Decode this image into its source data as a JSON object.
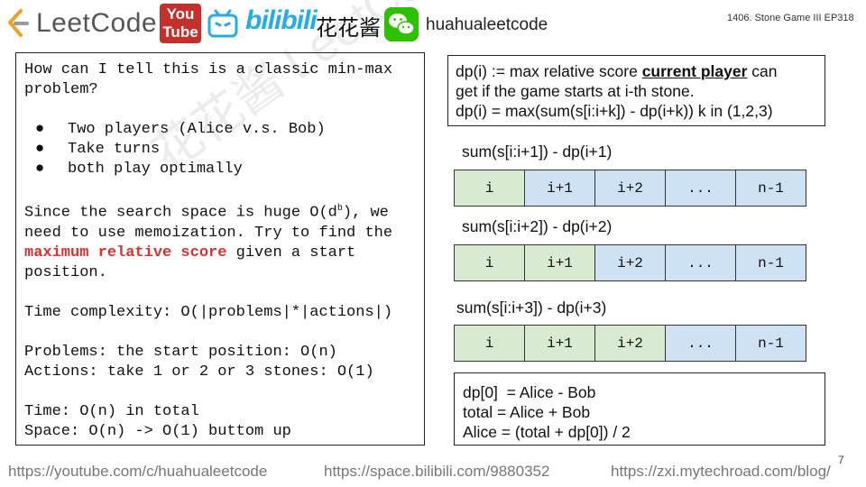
{
  "header": {
    "brand": "LeetCode",
    "youtube_top": "You",
    "youtube_bottom": "Tube",
    "bilibili": "bilibili",
    "chinese_name": "花花酱",
    "handle": "huahualeetcode",
    "slide_id": "1406. Stone Game III EP318"
  },
  "left": {
    "question": "How can I tell this is a classic min-max problem?",
    "bullets": [
      "Two players (Alice v.s. Bob)",
      "Take turns",
      "both play optimally"
    ],
    "memo_pre": "Since the search space is huge O(d",
    "memo_sup": "b",
    "memo_post": "), we need to use memoization. Try to find the",
    "memo_red": "maximum relative score",
    "memo_end": "given a start position.",
    "time_complexity": "Time complexity: O(|problems|*|actions|)",
    "problems": "Problems: the start position: O(n)",
    "actions": "Actions: take 1 or 2 or 3 stones: O(1)",
    "time": "Time: O(n) in total",
    "space": "Space: O(n) -> O(1) buttom up"
  },
  "definition": {
    "line1_pre": "dp(i) := max relative score",
    "line1_em": "current player",
    "line1_post": "can",
    "line2": "get if the game starts at i-th stone.",
    "line3": "dp(i) = max(sum(s[i:i+k]) - dp(i+k)) k in (1,2,3)"
  },
  "arrays": [
    {
      "label": "sum(s[i:i+1]) - dp(i+1)",
      "cells": [
        "i",
        "i+1",
        "i+2",
        "...",
        "n-1"
      ],
      "taken": 1
    },
    {
      "label": "sum(s[i:i+2]) - dp(i+2)",
      "cells": [
        "i",
        "i+1",
        "i+2",
        "...",
        "n-1"
      ],
      "taken": 2
    },
    {
      "label": "sum(s[i:i+3]) - dp(i+3)",
      "cells": [
        "i",
        "i+1",
        "i+2",
        "...",
        "n-1"
      ],
      "taken": 3
    }
  ],
  "summary": {
    "line1": "dp[0]  = Alice - Bob",
    "line2": "total = Alice + Bob",
    "line3": "Alice = (total + dp[0]) / 2"
  },
  "colors": {
    "taken": "#d9ead3",
    "rest": "#cfe2f3",
    "highlight": "#d9312b"
  },
  "page_number": "7",
  "watermark": "花花酱 LeetCode https://zxi.mytechroad.com/blog/",
  "footer": {
    "youtube": "https://youtube.com/c/huahualeetcode",
    "bilibili": "https://space.bilibili.com/9880352",
    "blog": "https://zxi.mytechroad.com/blog/"
  }
}
